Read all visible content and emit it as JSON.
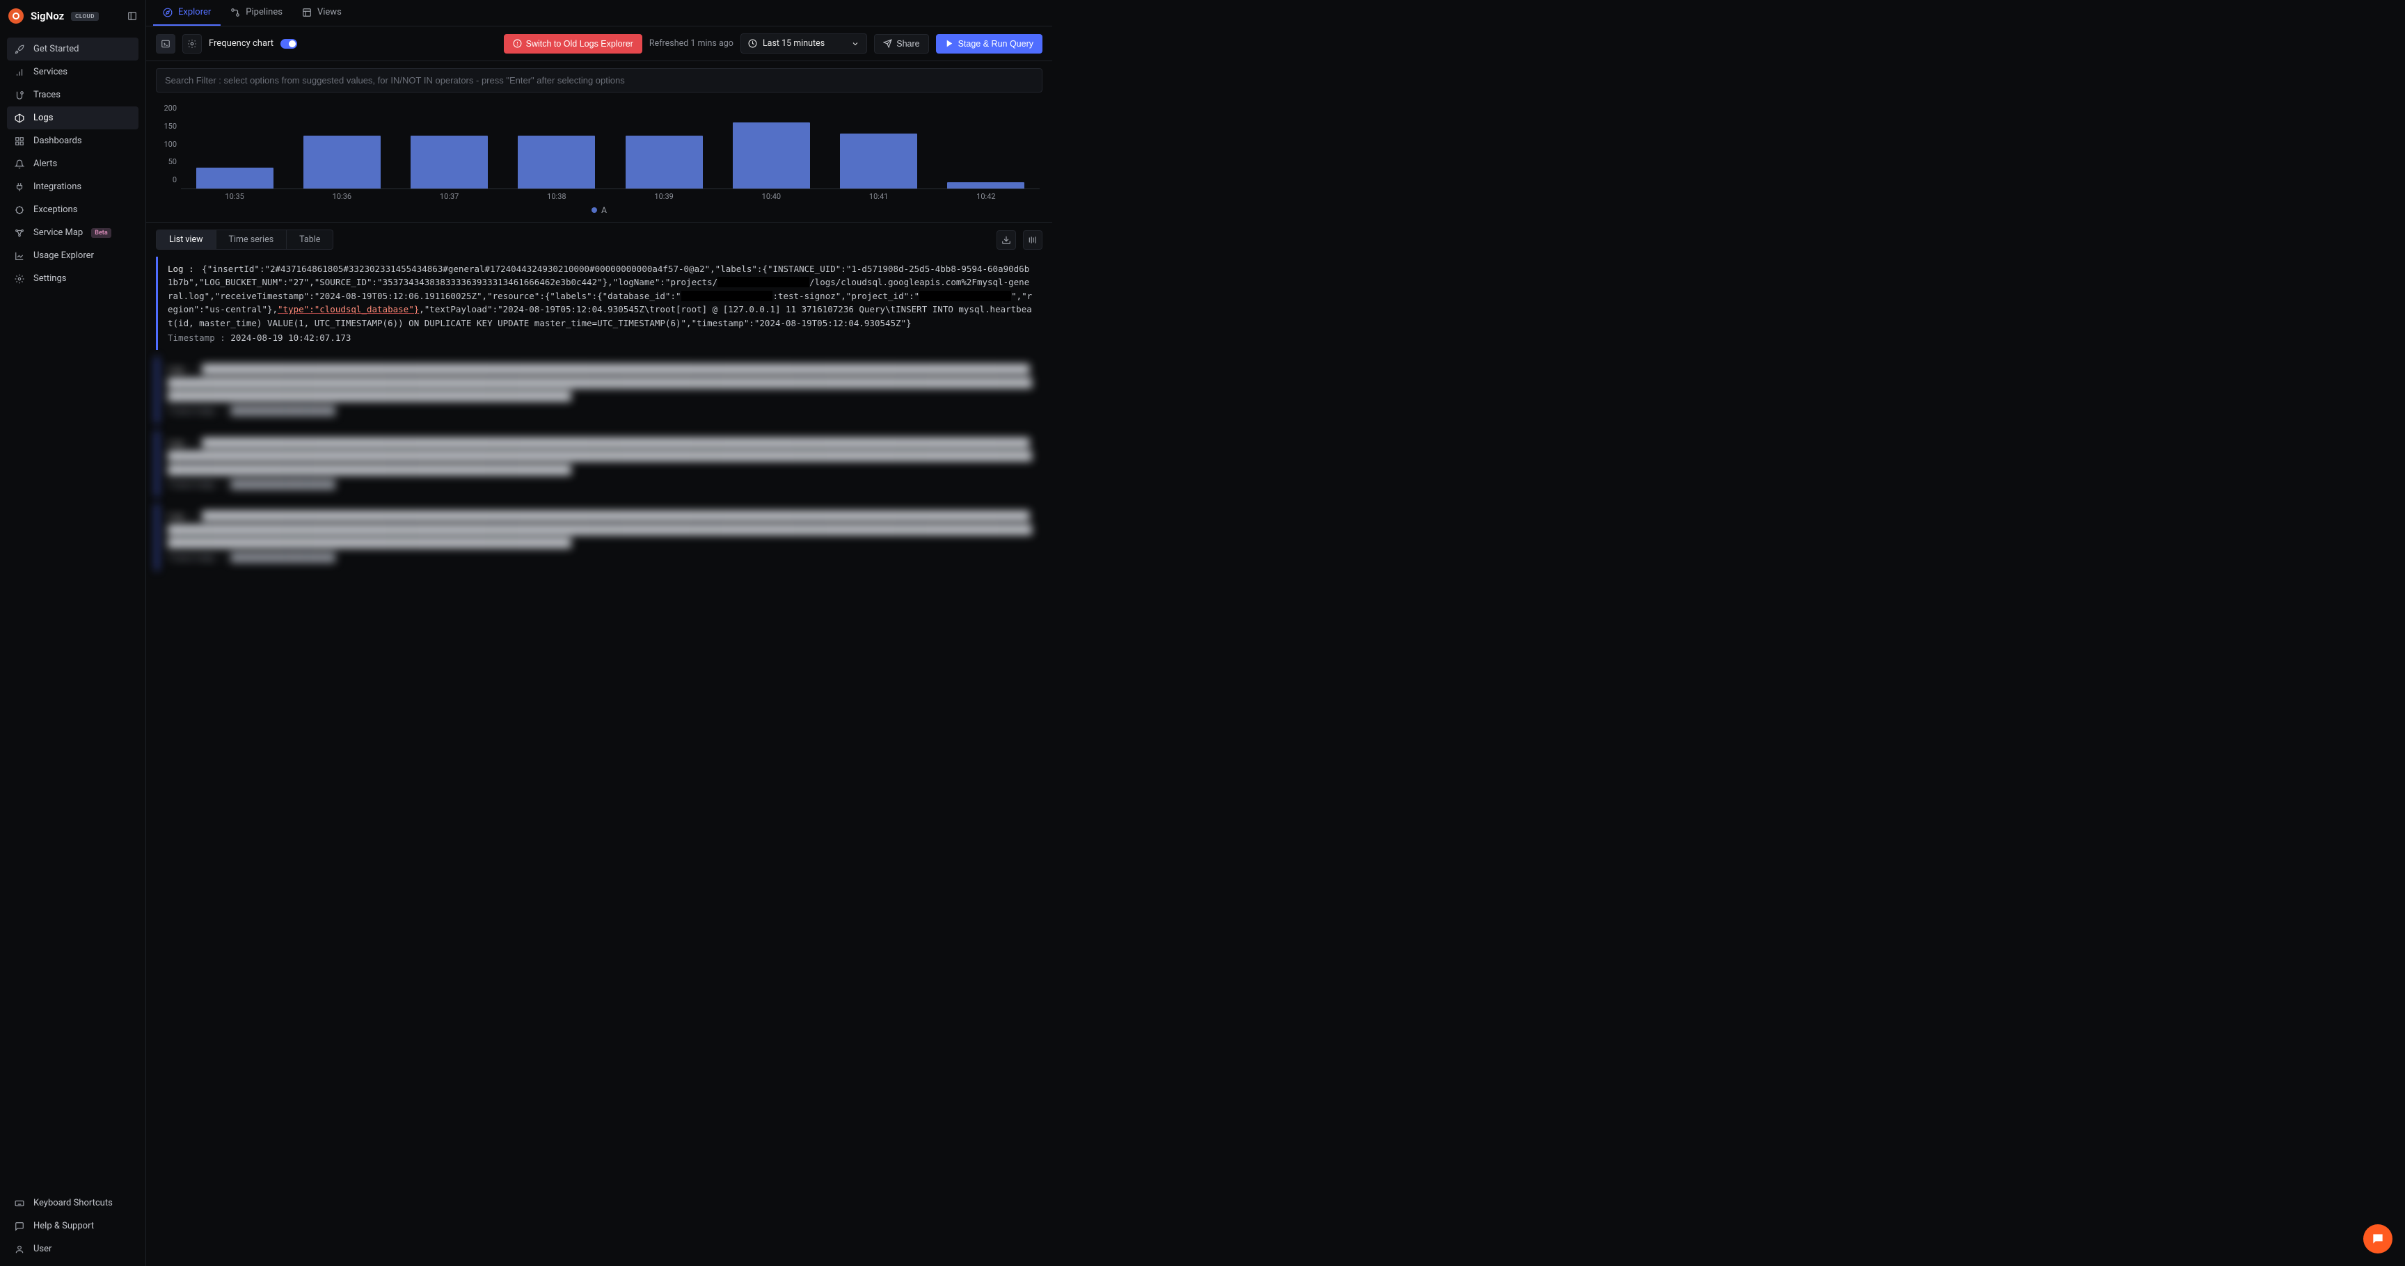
{
  "brand": "SigNoz",
  "cloud_badge": "CLOUD",
  "sidebar": {
    "items": [
      {
        "icon": "rocket",
        "label": "Get Started"
      },
      {
        "icon": "bar",
        "label": "Services"
      },
      {
        "icon": "trace",
        "label": "Traces"
      },
      {
        "icon": "logs",
        "label": "Logs"
      },
      {
        "icon": "grid",
        "label": "Dashboards"
      },
      {
        "icon": "bell",
        "label": "Alerts"
      },
      {
        "icon": "plug",
        "label": "Integrations"
      },
      {
        "icon": "bug",
        "label": "Exceptions"
      },
      {
        "icon": "map",
        "label": "Service Map",
        "beta": "Beta"
      },
      {
        "icon": "chart",
        "label": "Usage Explorer"
      },
      {
        "icon": "gear",
        "label": "Settings"
      }
    ],
    "footer": [
      {
        "icon": "keyboard",
        "label": "Keyboard Shortcuts"
      },
      {
        "icon": "help",
        "label": "Help & Support"
      },
      {
        "icon": "user",
        "label": "User"
      }
    ]
  },
  "top_tabs": [
    {
      "icon": "compass",
      "label": "Explorer"
    },
    {
      "icon": "pipeline",
      "label": "Pipelines"
    },
    {
      "icon": "views",
      "label": "Views"
    }
  ],
  "toolbar": {
    "freq_label": "Frequency chart",
    "switch_old": "Switch to Old Logs Explorer",
    "refreshed": "Refreshed 1 mins ago",
    "time_range": "Last 15 minutes",
    "share": "Share",
    "run": "Stage & Run Query"
  },
  "search": {
    "placeholder": "Search Filter : select options from suggested values, for IN/NOT IN operators - press \"Enter\" after selecting options"
  },
  "chart_data": {
    "type": "bar",
    "categories": [
      "10:35",
      "10:36",
      "10:37",
      "10:38",
      "10:39",
      "10:40",
      "10:41",
      "10:42"
    ],
    "values": [
      50,
      125,
      125,
      125,
      125,
      155,
      130,
      15
    ],
    "ylabel": "",
    "ylim": [
      0,
      200
    ],
    "y_ticks": [
      "200",
      "150",
      "100",
      "50",
      "0"
    ],
    "legend": "A"
  },
  "view_tabs": [
    "List view",
    "Time series",
    "Table"
  ],
  "logs": [
    {
      "label": "Log :",
      "body_pre": "{\"insertId\":\"2#437164861805#332302331455434863#general#1724044324930210000#00000000000a4f57-0@a2\",\"labels\":{\"INSTANCE_UID\":\"1-d571908d-25d5-4bb8-9594-60a90d6b1b7b\",\"LOG_BUCKET_NUM\":\"27\",\"SOURCE_ID\":\"353734343838333363933313461666462e3b0c442\"},\"logName\":\"projects/",
      "body_mid1": "/logs/cloudsql.googleapis.com%2Fmysql-general.log\",\"receiveTimestamp\":\"2024-08-19T05:12:06.191160025Z\",\"resource\":{\"labels\":{\"database_id\":\"",
      "body_mid2": ":test-signoz\",\"project_id\":\"",
      "body_mid3": "\",\"region\":\"us-central\"},",
      "highlight": "\"type\":\"cloudsql_database\"}",
      "body_post": ",\"textPayload\":\"2024-08-19T05:12:04.930545Z\\troot[root] @  [127.0.0.1] 11 3716107236 Query\\tINSERT INTO mysql.heartbeat(id, master_time) VALUE(1, UTC_TIMESTAMP(6)) ON DUPLICATE KEY UPDATE master_time=UTC_TIMESTAMP(6)\",\"timestamp\":\"2024-08-19T05:12:04.930545Z\"}",
      "ts_label": "Timestamp :",
      "ts_value": "2024-08-19 10:42:07.173"
    }
  ],
  "blurred_blocks": 3
}
